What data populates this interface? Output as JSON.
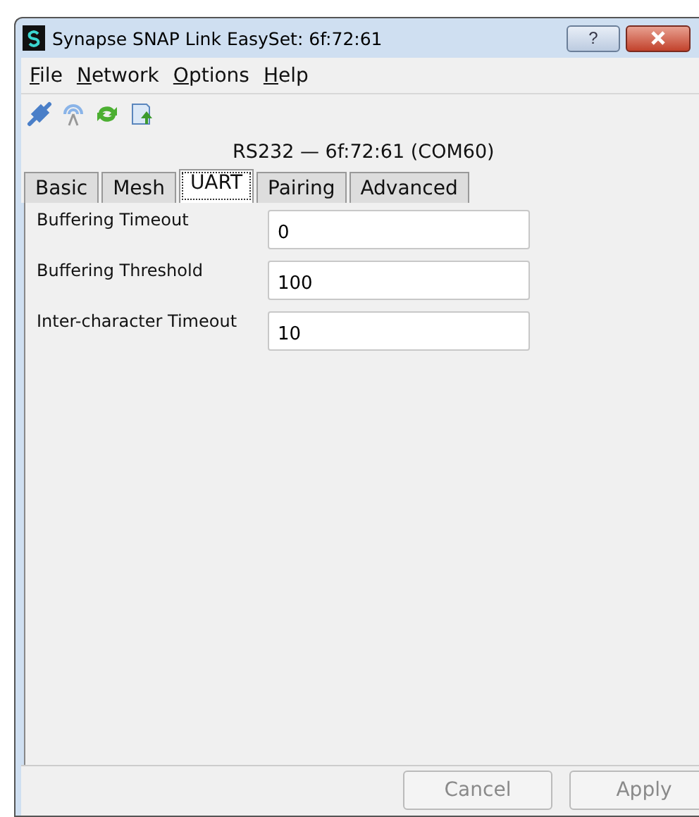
{
  "window": {
    "title": "Synapse SNAP Link EasySet: 6f:72:61",
    "help_button": "?"
  },
  "menu": [
    "File",
    "Network",
    "Options",
    "Help"
  ],
  "device_label": "RS232 — 6f:72:61 (COM60)",
  "tabs": [
    {
      "label": "Basic",
      "selected": false
    },
    {
      "label": "Mesh",
      "selected": false
    },
    {
      "label": "UART",
      "selected": true
    },
    {
      "label": "Pairing",
      "selected": false
    },
    {
      "label": "Advanced",
      "selected": false
    }
  ],
  "fields": [
    {
      "label": "Buffering Timeout",
      "value": "0"
    },
    {
      "label": "Buffering Threshold",
      "value": "100"
    },
    {
      "label": "Inter-character Timeout",
      "value": "10"
    }
  ],
  "buttons": [
    {
      "label": "Cancel",
      "disabled": true
    },
    {
      "label": "Apply",
      "disabled": true
    }
  ]
}
